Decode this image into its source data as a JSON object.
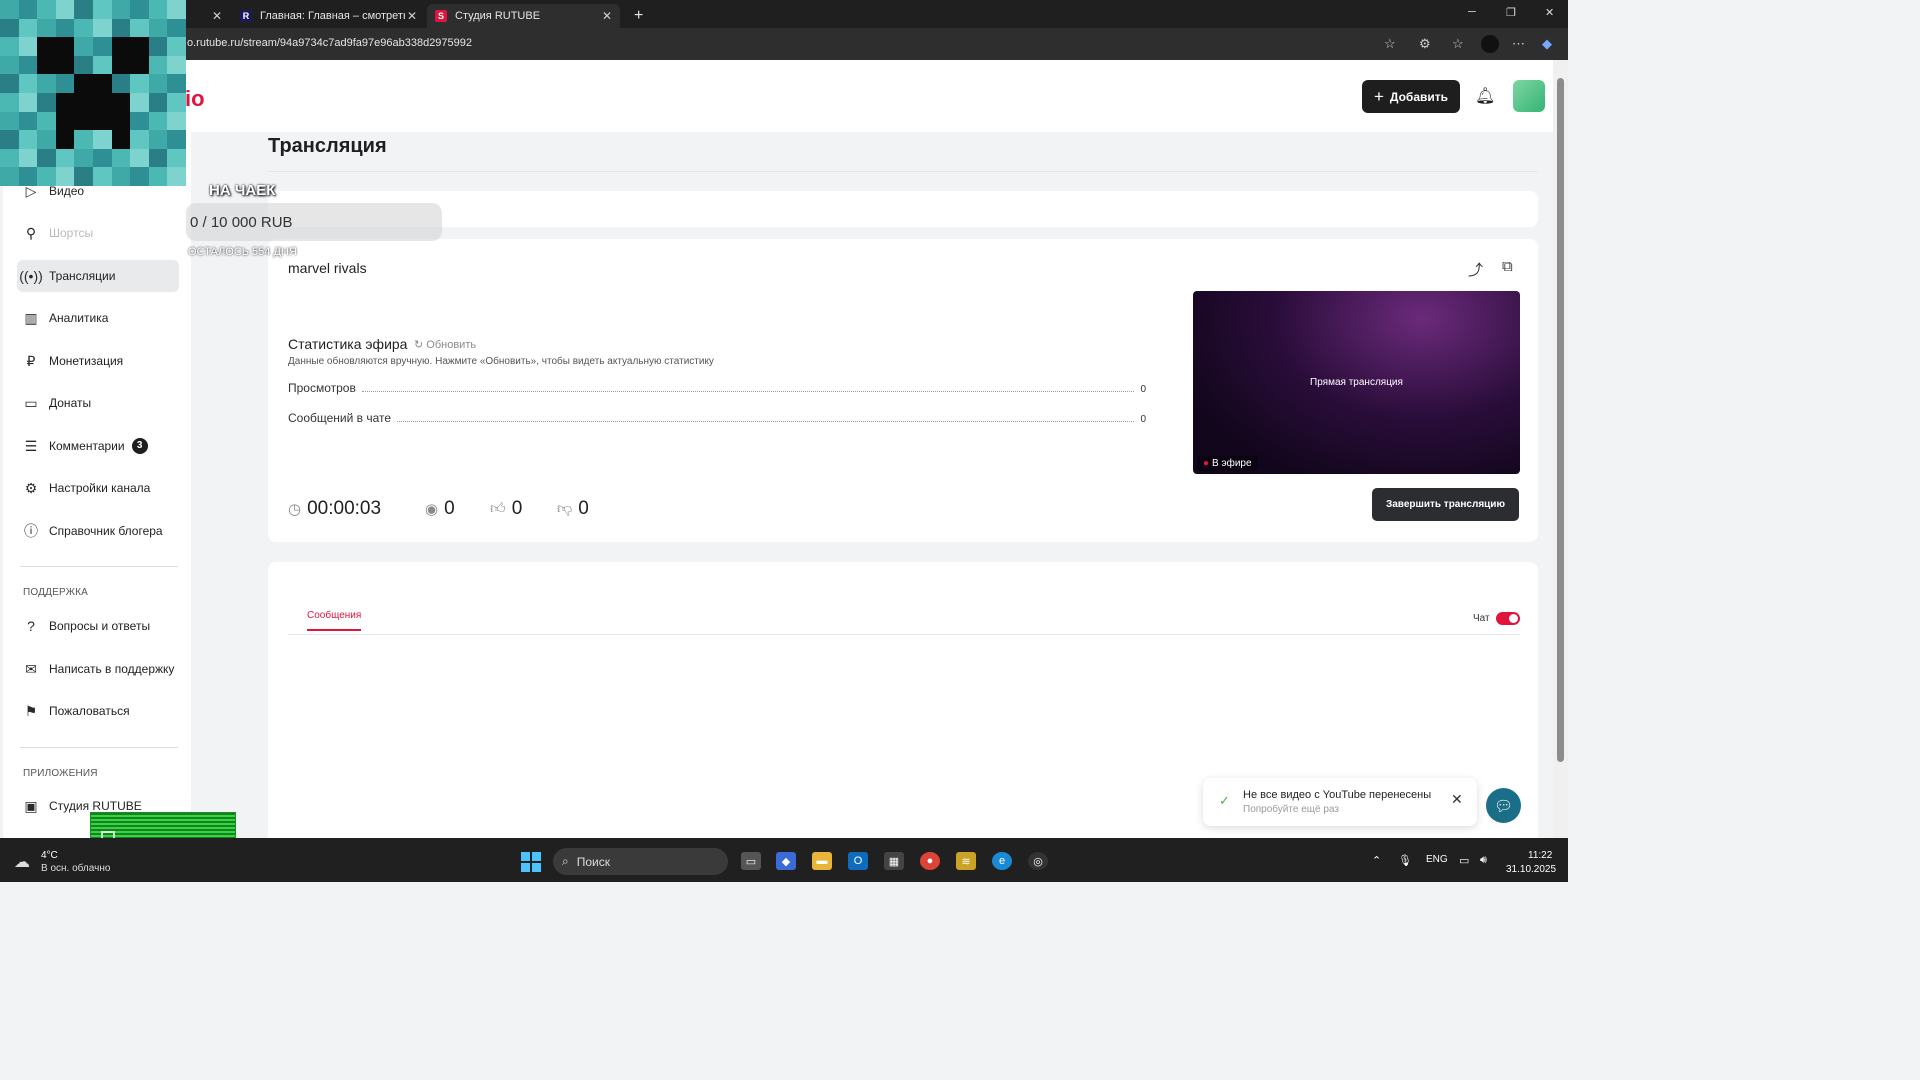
{
  "browser": {
    "tabs": [
      {
        "title": "",
        "close": "✕"
      },
      {
        "title": "Главная: Главная – смотреть он",
        "close": "✕"
      },
      {
        "title": "Студия RUTUBE",
        "close": "✕"
      }
    ],
    "new_tab": "+",
    "url": "o.rutube.ru/stream/94a9734c7ad9fa97e96ab338d2975992"
  },
  "header": {
    "logo_text": "io",
    "add_button": "Добавить"
  },
  "sidebar": {
    "items": [
      {
        "label": "Видео",
        "icon": "play-icon"
      },
      {
        "label": "Шортсы",
        "icon": "shorts-icon"
      },
      {
        "label": "Трансляции",
        "icon": "broadcast-icon",
        "active": true
      },
      {
        "label": "Аналитика",
        "icon": "analytics-icon"
      },
      {
        "label": "Монетизация",
        "icon": "ruble-icon"
      },
      {
        "label": "Донаты",
        "icon": "donate-icon"
      },
      {
        "label": "Комментарии",
        "icon": "comment-icon",
        "badge": "3"
      },
      {
        "label": "Настройки канала",
        "icon": "gear-icon"
      },
      {
        "label": "Справочник блогера",
        "icon": "info-icon"
      }
    ],
    "support_title": "ПОДДЕРЖКА",
    "support_items": [
      {
        "label": "Вопросы и ответы",
        "icon": "question-icon"
      },
      {
        "label": "Написать в поддержку",
        "icon": "mail-icon"
      },
      {
        "label": "Пожаловаться",
        "icon": "flag-icon"
      }
    ],
    "apps_title": "ПРИЛОЖЕНИЯ",
    "apps_items": [
      {
        "label": "Студия RUTUBE",
        "icon": "studio-icon"
      }
    ]
  },
  "main": {
    "page_title": "Трансляция",
    "stream": {
      "title": "marvel rivals",
      "stats_title": "Статистика эфира",
      "refresh_label": "Обновить",
      "stats_note": "Данные обновляются вручную. Нажмите «Обновить», чтобы видеть актуальную статистику",
      "rows": [
        {
          "label": "Просмотров",
          "value": "0"
        },
        {
          "label": "Сообщений в чате",
          "value": "0"
        }
      ],
      "duration": "00:00:03",
      "viewers": "0",
      "likes": "0",
      "dislikes": "0",
      "preview_text": "Прямая трансляция",
      "live_label": "В эфире",
      "end_button": "Завершить трансляцию"
    },
    "chat": {
      "tab_label": "Сообщения",
      "chat_toggle_label": "Чат",
      "chat_enabled": true
    }
  },
  "toast": {
    "title": "Не все видео с YouTube перенесены",
    "subtitle": "Попробуйте ещё раз"
  },
  "overlay": {
    "goal_title": "НА ЧАЕК",
    "goal_amount": "0 / 10 000 RUB",
    "goal_left": "ОСТАЛОСЬ 554 ДНЯ"
  },
  "taskbar": {
    "temperature": "4°C",
    "weather": "В осн. облачно",
    "search_placeholder": "Поиск",
    "language": "ENG",
    "time": "11:22",
    "date": "31.10.2025"
  },
  "colors": {
    "accent": "#e0143c",
    "dark_button": "#1e1e1e"
  }
}
